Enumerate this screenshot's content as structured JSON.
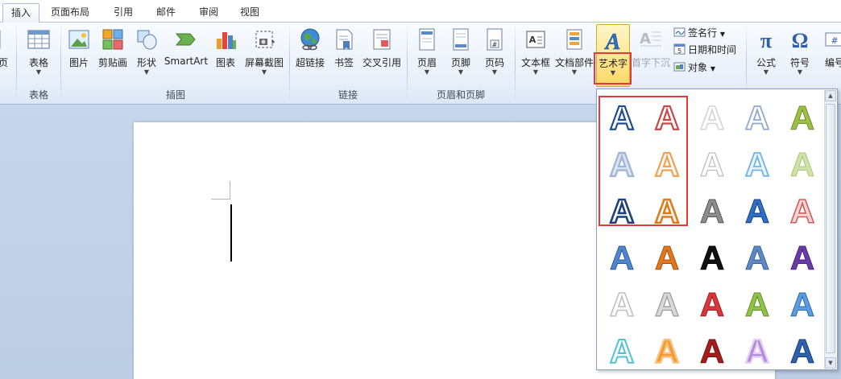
{
  "tabs": [
    "插入",
    "页面布局",
    "引用",
    "邮件",
    "审阅",
    "视图"
  ],
  "active_tab": "插入",
  "ribbon": {
    "partial_left_label": "页",
    "groups": {
      "tables": {
        "label": "表格",
        "table_button": "表格"
      },
      "illustrations": {
        "label": "插图",
        "picture": "图片",
        "clipart": "剪贴画",
        "shapes": "形状",
        "smartart": "SmartArt",
        "chart": "图表",
        "screenshot": "屏幕截图"
      },
      "links": {
        "label": "链接",
        "hyperlink": "超链接",
        "bookmark": "书签",
        "crossref": "交叉引用"
      },
      "header_footer": {
        "label": "页眉和页脚",
        "header": "页眉",
        "footer": "页脚",
        "page_number": "页码"
      },
      "text": {
        "textbox": "文本框",
        "quickparts": "文档部件",
        "wordart": "艺术字",
        "dropcap": "首字下沉",
        "signature_line": "签名行",
        "date_time": "日期和时间",
        "object": "对象"
      },
      "symbols": {
        "equation": "公式",
        "symbol": "符号",
        "number": "编号"
      }
    }
  },
  "wordart_gallery": {
    "styles": [
      [
        "outline-blue",
        "outline-red",
        "outline-white",
        "outline-lightblue",
        "fill-olive"
      ],
      [
        "soft-blue",
        "outline-orange",
        "fill-white-gray",
        "outline-skyblue",
        "fill-lightgreen"
      ],
      [
        "outline-navy",
        "outline-amber",
        "fill-silver",
        "fill-blue-bevel",
        "outline-pink"
      ],
      [
        "fill-blue-reflect",
        "fill-orange-bevel",
        "fill-black",
        "fill-steelblue",
        "fill-purple"
      ],
      [
        "outline-gray",
        "fill-silver-metal",
        "fill-red",
        "fill-green",
        "fill-blue-reflect2"
      ],
      [
        "outline-cyan",
        "fill-orange-glow",
        "fill-darkred",
        "fill-violet-glow",
        "fill-blue-3d"
      ]
    ],
    "glyph": "A"
  },
  "colors": {
    "highlight": "#e03a3a",
    "ribbon_top": "#f8fbff",
    "doc_background": "#c7d6ea"
  }
}
